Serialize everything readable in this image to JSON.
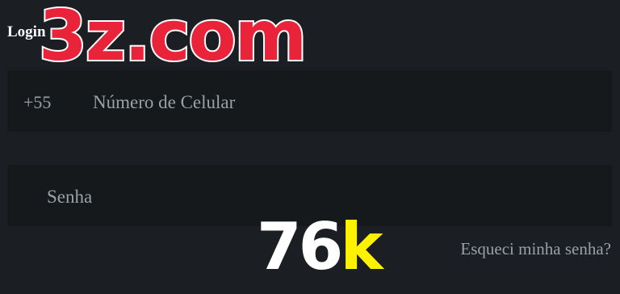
{
  "login": {
    "title": "Login",
    "phone": {
      "prefix": "+55",
      "placeholder": "Número de Celular"
    },
    "password": {
      "placeholder": "Senha"
    },
    "forgot_label": "Esqueci minha senha?"
  },
  "overlay": {
    "logo_text": "3z.com",
    "count_number": "76",
    "count_suffix": "k",
    "logo_color": "#e8233a",
    "count_suffix_color": "#fff200"
  }
}
